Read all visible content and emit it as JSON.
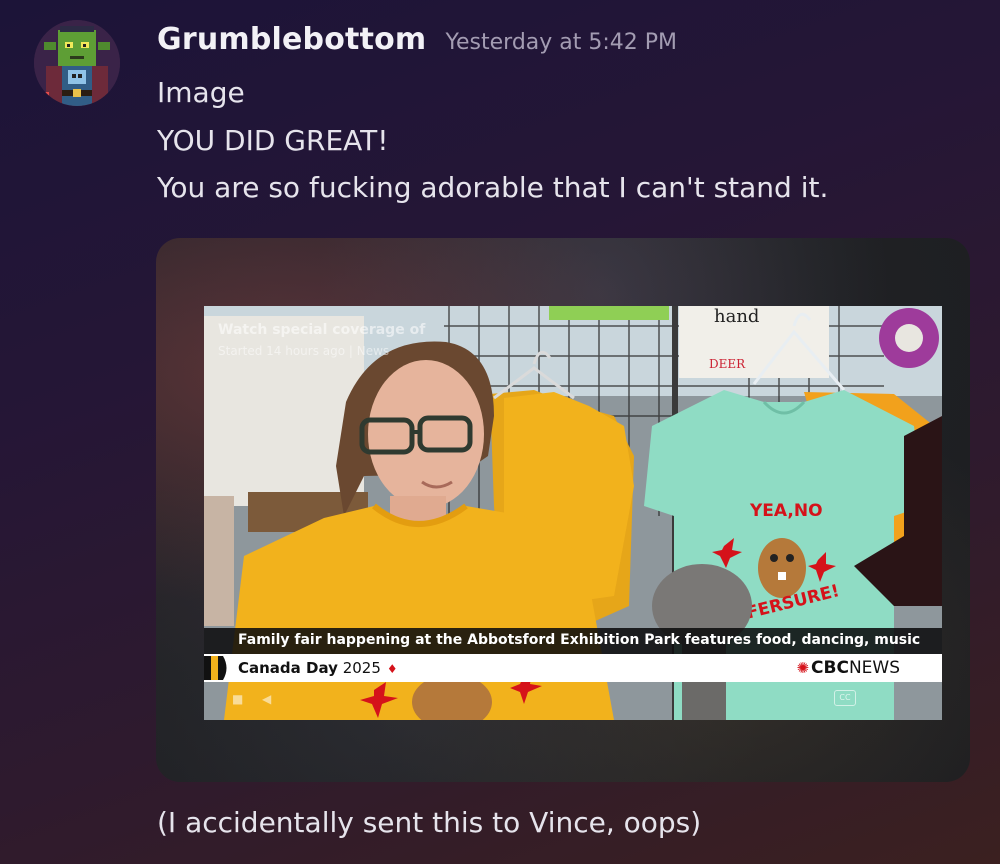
{
  "message": {
    "author": "Grumblebottom",
    "timestamp": "Yesterday at 5:42 PM",
    "lines": [
      "Image",
      "YOU DID GREAT!",
      "You are so fucking adorable that I can't stand it."
    ],
    "followup": "(I accidentally sent this to Vince, oops)"
  },
  "avatar": {
    "icon": "pixel-goblin-avatar-icon"
  },
  "video": {
    "overlay_title": "Watch special coverage of",
    "overlay_subtitle": "Started 14 hours ago | News",
    "headline": "Family fair happening at the Abbotsford Exhibition Park features food, dancing, music",
    "program_title": "Canada Day",
    "program_year": "2025",
    "network_prefix": "CBC",
    "network_suffix": "NEWS",
    "tshirt_slogan_top": "YEA,NO",
    "tshirt_slogan_bottom": "FERSURE!",
    "sign_text": "hand",
    "cc_label": "CC"
  },
  "colors": {
    "background_top": "#1c1438",
    "background_bottom": "#3b2020",
    "mustard_shirt": "#f2b21c",
    "mint_shirt": "#8fdcc4",
    "cbc_red": "#d5121a"
  }
}
